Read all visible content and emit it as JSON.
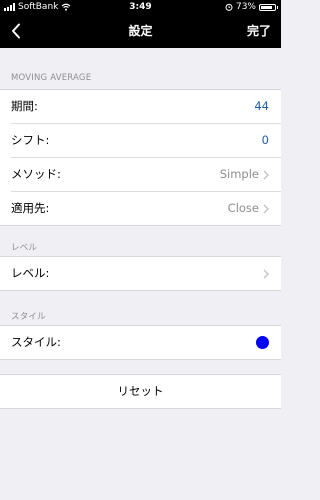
{
  "status_bar": {
    "carrier": "SoftBank",
    "time": "3:49",
    "battery_percent": "73%",
    "battery_level": 0.73
  },
  "nav": {
    "title": "設定",
    "done_label": "完了",
    "back_icon": "chevron-left-icon"
  },
  "sections": {
    "moving_average": {
      "header": "MOVING AVERAGE",
      "rows": {
        "period": {
          "label": "期間:",
          "value": "44"
        },
        "shift": {
          "label": "シフト:",
          "value": "0"
        },
        "method": {
          "label": "メソッド:",
          "value": "Simple"
        },
        "apply_to": {
          "label": "適用先:",
          "value": "Close"
        }
      }
    },
    "level": {
      "header": "レベル",
      "rows": {
        "level": {
          "label": "レベル:"
        }
      }
    },
    "style": {
      "header": "スタイル",
      "rows": {
        "style": {
          "label": "スタイル:",
          "color": "#0000ff"
        }
      }
    }
  },
  "reset_label": "リセット",
  "colors": {
    "accent": "#1f5fa8",
    "nav_background": "#000000",
    "page_background": "#efeff4"
  }
}
